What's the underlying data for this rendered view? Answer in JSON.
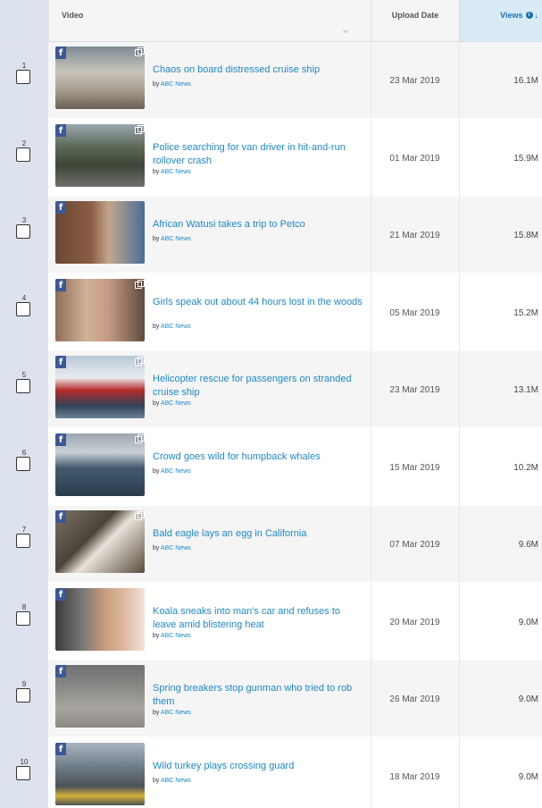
{
  "header": {
    "video_label": "Video",
    "upload_date_label": "Upload Date",
    "views_label": "Views",
    "info_icon": "info-icon",
    "sort_icon": "sort-desc-icon"
  },
  "badge_letter": "f",
  "by_prefix": "by",
  "rows": [
    {
      "rank": "1",
      "title": "Chaos on board distressed cruise ship",
      "channel": "ABC News",
      "date": "23 Mar 2019",
      "views": "16.1M",
      "popout": true
    },
    {
      "rank": "2",
      "title": "Police searching for van driver in hit-and-run rollover crash",
      "channel": "ABC News",
      "date": "01 Mar 2019",
      "views": "15.9M",
      "popout": true
    },
    {
      "rank": "3",
      "title": "African Watusi takes a trip to Petco",
      "channel": "ABC News",
      "date": "21 Mar 2019",
      "views": "15.8M",
      "popout": false
    },
    {
      "rank": "4",
      "title": "Girls speak out about 44 hours lost in the woods",
      "channel": "ABC News",
      "date": "05 Mar 2019",
      "views": "15.2M",
      "popout": true
    },
    {
      "rank": "5",
      "title": "Helicopter rescue for passengers on stranded cruise ship",
      "channel": "ABC News",
      "date": "23 Mar 2019",
      "views": "13.1M",
      "popout": true
    },
    {
      "rank": "6",
      "title": "Crowd goes wild for humpback whales",
      "channel": "ABC News",
      "date": "15 Mar 2019",
      "views": "10.2M",
      "popout": true
    },
    {
      "rank": "7",
      "title": "Bald eagle lays an egg in California",
      "channel": "ABC News",
      "date": "07 Mar 2019",
      "views": "9.6M",
      "popout": true
    },
    {
      "rank": "8",
      "title": "Koala sneaks into man's car and refuses to leave amid blistering heat",
      "channel": "ABC News",
      "date": "20 Mar 2019",
      "views": "9.0M",
      "popout": false
    },
    {
      "rank": "9",
      "title": "Spring breakers stop gunman who tried to rob them",
      "channel": "ABC News",
      "date": "26 Mar 2019",
      "views": "9.0M",
      "popout": false
    },
    {
      "rank": "10",
      "title": "Wild turkey plays crossing guard",
      "channel": "ABC News",
      "date": "18 Mar 2019",
      "views": "9.0M",
      "popout": false
    }
  ]
}
